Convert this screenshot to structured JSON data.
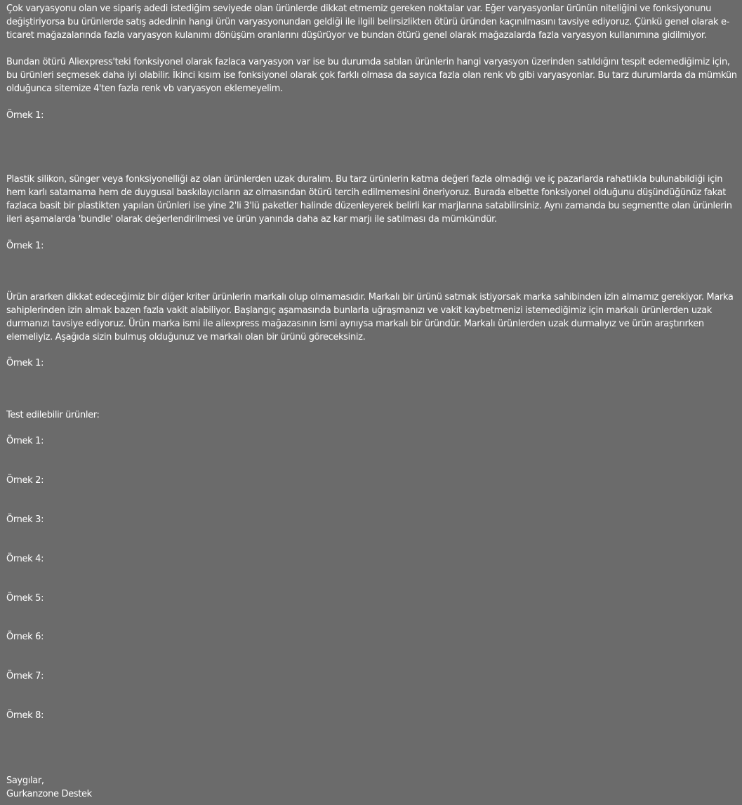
{
  "email": {
    "paragraphs": [
      "Çok varyasyonu olan ve sipariş adedi istediğim seviyede olan ürünlerde dikkat etmemiz gereken noktalar var. Eğer varyasyonlar ürünün niteliğini ve fonksiyonunu değiştiriyorsa bu ürünlerde satış adedinin hangi ürün varyasyonundan geldiği ile ilgili belirsizlikten ötürü üründen kaçınılmasını tavsiye ediyoruz. Çünkü genel olarak e-ticaret mağazalarında fazla varyasyon kulanımı dönüşüm oranlarını düşürüyor ve bundan ötürü genel olarak mağazalarda fazla varyasyon kullanımına gidilmiyor.",
      "Bundan ötürü Aliexpress'teki fonksiyonel olarak fazlaca varyasyon var ise bu durumda satılan ürünlerin hangi varyasyon üzerinden satıldığını tespit edemediğimiz için, bu ürünleri seçmesek daha iyi olabilir. İkinci kısım ise fonksiyonel olarak çok farklı olmasa da sayıca fazla olan renk vb gibi varyasyonlar. Bu tarz durumlarda da mümkün olduğunca sitemize 4'ten fazla renk vb varyasyon eklemeyelim.",
      "Plastik silikon, sünger veya fonksiyonelliği az olan ürünlerden uzak duralım. Bu tarz ürünlerin katma değeri fazla olmadığı ve iç pazarlarda rahatlıkla bulunabildiği için hem karlı satamama hem de duygusal baskılayıcıların az olmasından ötürü tercih edilmemesini öneriyoruz. Burada elbette fonksiyonel olduğunu düşündüğünüz fakat fazlaca basit bir plastikten yapılan ürünleri ise yine 2'li 3'lü paketler halinde düzenleyerek belirli kar marjlarına satabilirsiniz. Aynı zamanda bu segmentte olan ürünlerin ileri aşamalarda 'bundle' olarak değerlendirilmesi ve ürün yanında daha az kar marjı ile satılması da mümkündür.",
      "Ürün ararken dikkat edeceğimiz bir diğer kriter ürünlerin markalı olup olmamasıdır. Markalı bir ürünü satmak istiyorsak marka sahibinden izin almamız gerekiyor. Marka sahiplerinden izin almak bazen fazla vakit alabiliyor. Başlangıç aşamasında bunlarla uğraşmanızı ve vakit kaybetmenizi istemediğimiz için markalı ürünlerden uzak durmanızı tavsiye ediyoruz. Ürün marka ismi ile aliexpress mağazasının ismi aynıysa markalı bir üründür. Markalı ürünlerden uzak durmalıyız ve ürün araştırırken elemeliyiz. Aşağıda sizin bulmuş olduğunuz ve markalı olan bir ürünü göreceksiniz."
    ],
    "example_labels": [
      "Örnek 1:",
      "Örnek 1:",
      "Örnek 1:"
    ],
    "testable_heading": "Test edilebilir ürünler:",
    "testable_examples": [
      "Örnek 1:",
      "Örnek 2:",
      "Örnek 3:",
      "Örnek 4:",
      "Örnek 5:",
      "Örnek 6:",
      "Örnek 7:",
      "Örnek 8:"
    ],
    "closing": "Saygılar,",
    "signature": "Gurkanzone Destek"
  }
}
